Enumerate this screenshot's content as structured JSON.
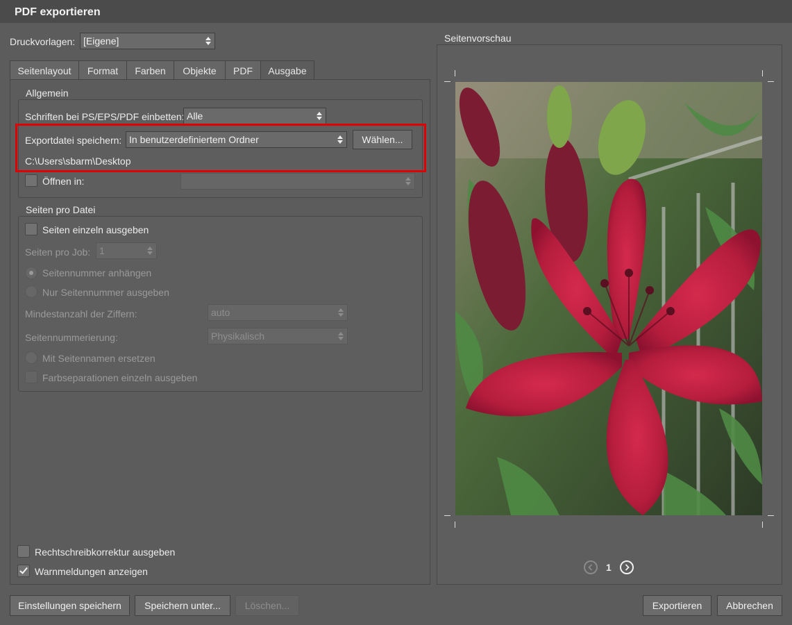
{
  "window": {
    "title": "PDF exportieren"
  },
  "presets": {
    "label": "Druckvorlagen:",
    "value": "[Eigene]"
  },
  "tabs": [
    {
      "label": "Seitenlayout"
    },
    {
      "label": "Format"
    },
    {
      "label": "Farben"
    },
    {
      "label": "Objekte"
    },
    {
      "label": "PDF"
    },
    {
      "label": "Ausgabe"
    }
  ],
  "general": {
    "title": "Allgemein",
    "embed_fonts_label": "Schriften bei PS/EPS/PDF einbetten:",
    "embed_fonts_value": "Alle",
    "save_export_label": "Exportdatei speichern:",
    "save_export_value": "In benutzerdefiniertem Ordner",
    "choose_button": "Wählen...",
    "path": "C:\\Users\\sbarm\\Desktop",
    "open_in_label": "Öffnen in:",
    "open_in_value": ""
  },
  "pages_per_file": {
    "title": "Seiten pro Datei",
    "single_pages_label": "Seiten einzeln ausgeben",
    "pages_per_job_label": "Seiten pro Job:",
    "pages_per_job_value": "1",
    "append_page_number_label": "Seitennummer anhängen",
    "only_page_number_label": "Nur Seitennummer ausgeben",
    "min_digits_label": "Mindestanzahl der Ziffern:",
    "min_digits_value": "auto",
    "numbering_label": "Seitennummerierung:",
    "numbering_value": "Physikalisch",
    "replace_with_names_label": "Mit Seitennamen ersetzen",
    "separations_label": "Farbseparationen einzeln ausgeben"
  },
  "options": {
    "spellcheck_label": "Rechtschreibkorrektur ausgeben",
    "spellcheck_checked": false,
    "warnings_label": "Warnmeldungen anzeigen",
    "warnings_checked": true
  },
  "preview": {
    "title": "Seitenvorschau",
    "page": "1"
  },
  "footer": {
    "save_settings": "Einstellungen speichern",
    "save_as": "Speichern unter...",
    "delete": "Löschen...",
    "export": "Exportieren",
    "cancel": "Abbrechen"
  },
  "colors": {
    "highlight": "#e00000",
    "background": "#5c5c5c"
  }
}
